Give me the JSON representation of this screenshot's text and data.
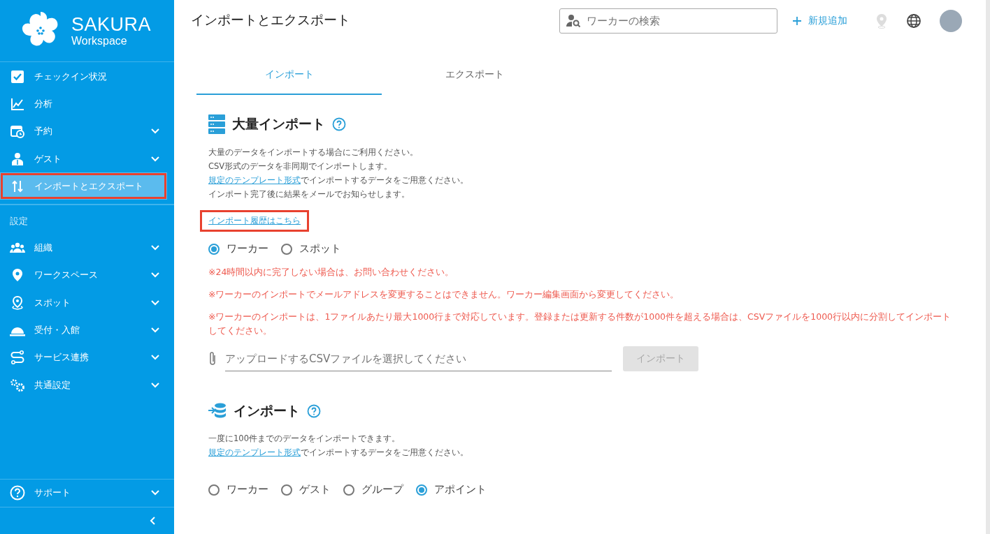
{
  "brand": {
    "name": "SAKURA",
    "sub": "Workspace"
  },
  "sidebar": {
    "items": [
      {
        "label": "チェックイン状況",
        "selected": false,
        "highlighted": false
      },
      {
        "label": "分析",
        "selected": false,
        "highlighted": false
      },
      {
        "label": "予約",
        "expanded": false,
        "selected": false,
        "highlighted": false
      },
      {
        "label": "ゲスト",
        "expanded": false,
        "selected": false,
        "highlighted": false
      },
      {
        "label": "インポートとエクスポート",
        "selected": true,
        "highlighted": true
      }
    ],
    "section_label": "設定",
    "settings_items": [
      {
        "label": "組織",
        "expanded": false
      },
      {
        "label": "ワークスペース",
        "expanded": false
      },
      {
        "label": "スポット",
        "expanded": false
      },
      {
        "label": "受付・入館",
        "expanded": false
      },
      {
        "label": "サービス連携",
        "expanded": false
      },
      {
        "label": "共通設定",
        "expanded": false
      }
    ],
    "support": {
      "label": "サポート",
      "expanded": false
    }
  },
  "header": {
    "title": "インポートとエクスポート",
    "search": {
      "placeholder": "ワーカーの検索"
    },
    "add_button": "新規追加"
  },
  "tabs": [
    {
      "label": "インポート",
      "selected": true
    },
    {
      "label": "エクスポート",
      "selected": false
    }
  ],
  "bulk_import": {
    "title": "大量インポート",
    "lines": [
      {
        "text": "大量のデータをインポートする場合にご利用ください。"
      },
      {
        "text": "CSV形式のデータを非同期でインポートします。"
      },
      {
        "link": "規定のテンプレート形式",
        "text": "でインポートするデータをご用意ください。"
      },
      {
        "text": "インポート完了後に結果をメールでお知らせします。"
      }
    ],
    "history_link": {
      "label": "インポート履歴はこちら",
      "highlighted": true
    },
    "options": [
      {
        "label": "ワーカー",
        "selected": true
      },
      {
        "label": "スポット",
        "selected": false
      }
    ],
    "notes": [
      "※24時間以内に完了しない場合は、お問い合わせください。",
      "※ワーカーのインポートでメールアドレスを変更することはできません。ワーカー編集画面から変更してください。",
      "※ワーカーのインポートは、1ファイルあたり最大1000行まで対応しています。登録または更新する件数が1000件を超える場合は、CSVファイルを1000行以内に分割してインポートしてください。"
    ],
    "file": {
      "placeholder": "アップロードするCSVファイルを選択してください"
    },
    "button": {
      "label": "インポート",
      "disabled": true
    }
  },
  "import": {
    "title": "インポート",
    "lines": [
      {
        "text": "一度に100件までのデータをインポートできます。"
      },
      {
        "link": "規定のテンプレート形式",
        "text": "でインポートするデータをご用意ください。"
      }
    ],
    "options": [
      {
        "label": "ワーカー",
        "selected": false
      },
      {
        "label": "ゲスト",
        "selected": false
      },
      {
        "label": "グループ",
        "selected": false
      },
      {
        "label": "アポイント",
        "selected": true
      }
    ]
  }
}
